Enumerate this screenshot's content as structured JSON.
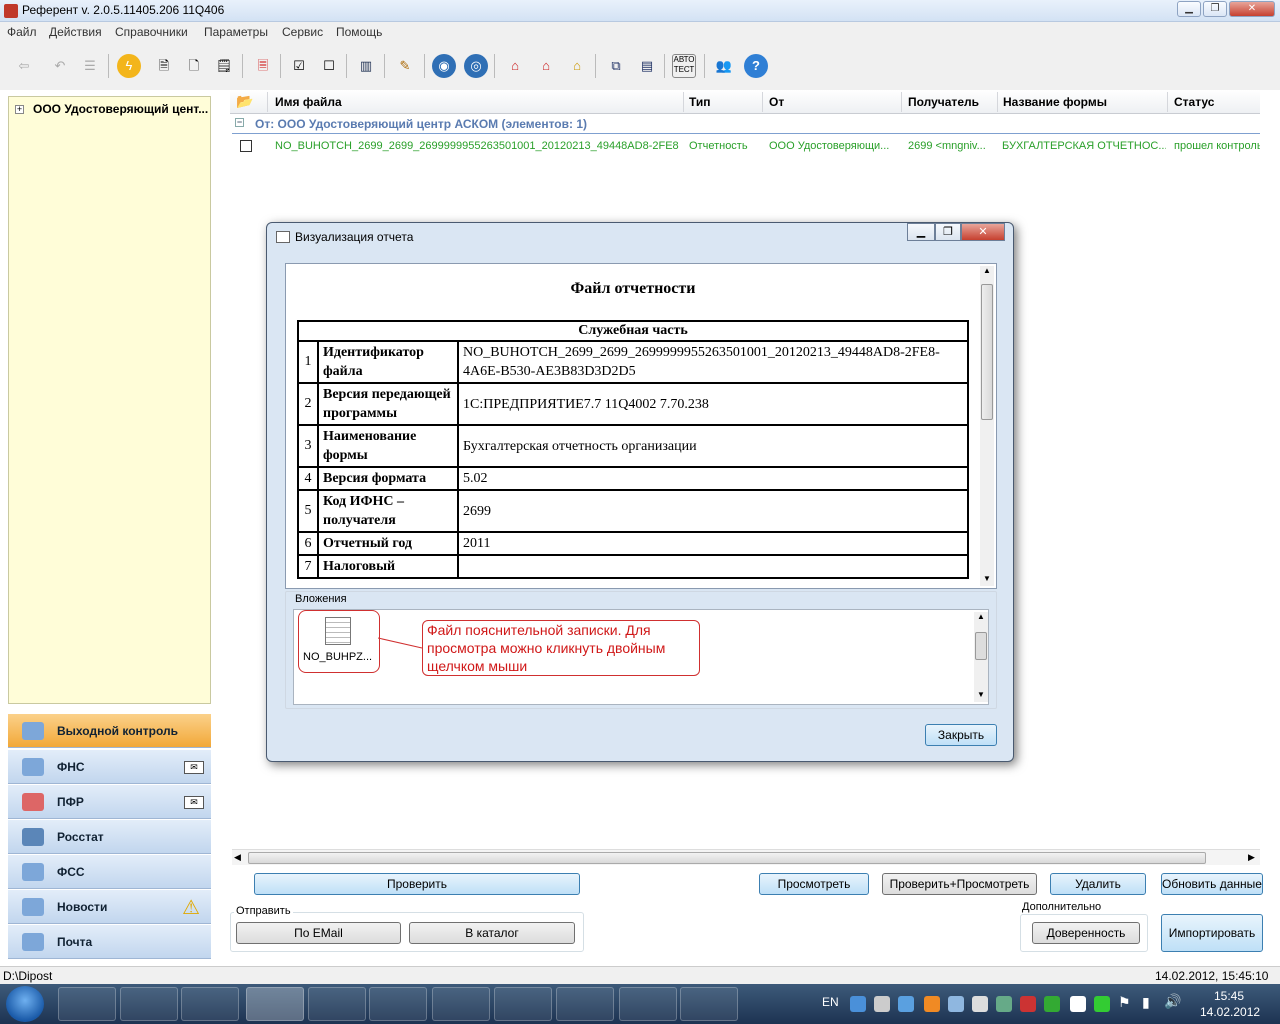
{
  "window": {
    "title": "Референт v. 2.0.5.11405.206 11Q406"
  },
  "menu": [
    "Файл",
    "Действия",
    "Справочники",
    "Параметры",
    "Сервис",
    "Помощь"
  ],
  "tree": {
    "root_label": "ООО Удостоверяющий цент..."
  },
  "nav": [
    {
      "label": "Выходной контроль",
      "active": true,
      "badge": ""
    },
    {
      "label": "ФНС",
      "active": false,
      "badge": "envelope"
    },
    {
      "label": "ПФР",
      "active": false,
      "badge": "envelope"
    },
    {
      "label": "Росстат",
      "active": false,
      "badge": ""
    },
    {
      "label": "ФСС",
      "active": false,
      "badge": ""
    },
    {
      "label": "Новости",
      "active": false,
      "badge": "warning"
    },
    {
      "label": "Почта",
      "active": false,
      "badge": ""
    }
  ],
  "list": {
    "columns": [
      "Имя файла",
      "Тип",
      "От",
      "Получатель",
      "Название формы",
      "Статус"
    ],
    "group_label": "От: ООО Удостоверяющий центр АСКОМ (элементов: 1)",
    "group_toggle": "−",
    "rows": [
      {
        "file": "NO_BUHOTCH_2699_2699_2699999955263501001_20120213_49448AD8-2FE8...",
        "type": "Отчетность",
        "from": "ООО Удостоверяющи...",
        "recipient": "2699 <mngniv...",
        "form": "БУХГАЛТЕРСКАЯ ОТЧЕТНОС...",
        "status": "прошел контроль"
      }
    ]
  },
  "buttons": {
    "check": "Проверить",
    "view": "Просмотреть",
    "check_view": "Проверить+Просмотреть",
    "delete": "Удалить",
    "refresh": "Обновить данные",
    "send_label": "Отправить",
    "by_email": "По EMail",
    "to_catalog": "В каталог",
    "extra_label": "Дополнительно",
    "trust": "Доверенность",
    "import": "Импортировать"
  },
  "status": {
    "path": "D:\\Dipost",
    "datetime": "14.02.2012, 15:45:10"
  },
  "taskbar": {
    "lang": "EN",
    "time": "15:45",
    "date": "14.02.2012"
  },
  "dialog": {
    "title": "Визуализация отчета",
    "doc_title": "Файл отчетности",
    "section": "Служебная часть",
    "rows": [
      {
        "n": "1",
        "k": "Идентификатор файла",
        "v": "NO_BUHOTCH_2699_2699_2699999955263501001_20120213_49448AD8-2FE8-4A6E-B530-AE3B83D3D2D5"
      },
      {
        "n": "2",
        "k": "Версия передающей программы",
        "v": "1С:ПРЕДПРИЯТИЕ7.7 11Q4002 7.70.238"
      },
      {
        "n": "3",
        "k": "Наименование формы",
        "v": "Бухгалтерская отчетность организации"
      },
      {
        "n": "4",
        "k": "Версия формата",
        "v": "5.02"
      },
      {
        "n": "5",
        "k": "Код ИФНС – получателя",
        "v": "2699"
      },
      {
        "n": "6",
        "k": "Отчетный год",
        "v": "2011"
      },
      {
        "n": "7",
        "k": "Налоговый",
        "v": ""
      }
    ],
    "attachments_label": "Вложения",
    "attachment_name": "NO_BUHPZ...",
    "callout": "Файл пояснительной записки. Для просмотра можно кликнуть двойным щелчком мыши",
    "close": "Закрыть"
  }
}
